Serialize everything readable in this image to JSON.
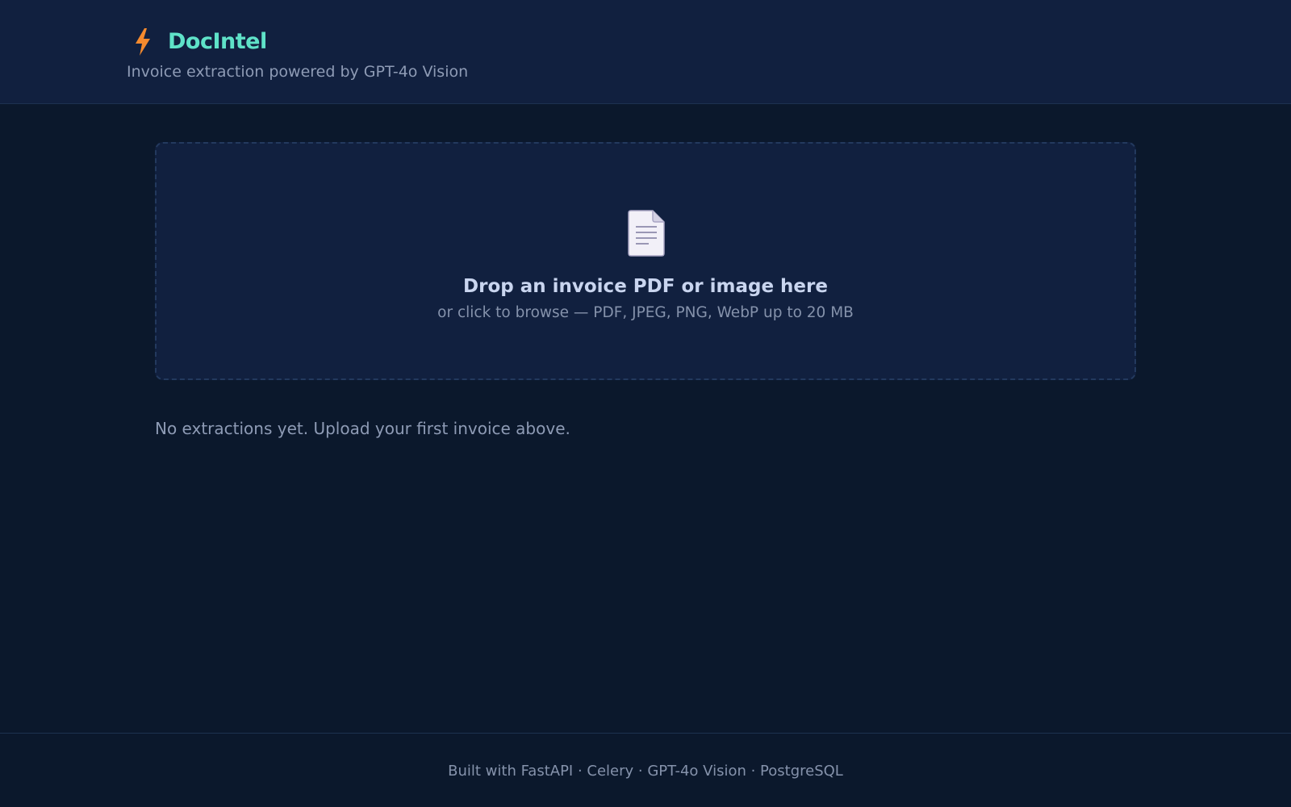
{
  "header": {
    "app_name": "DocIntel",
    "logo_icon": "lightning-bolt-icon",
    "tagline": "Invoice extraction powered by GPT-4o Vision"
  },
  "upload": {
    "icon": "document-icon",
    "title": "Drop an invoice PDF or image here",
    "subtitle": "or click to browse — PDF, JPEG, PNG, WebP up to 20 MB"
  },
  "extractions": {
    "empty_message": "No extractions yet. Upload your first invoice above."
  },
  "footer": {
    "text": "Built with FastAPI · Celery · GPT-4o Vision · PostgreSQL"
  },
  "colors": {
    "background": "#0b182c",
    "header_background": "#11203f",
    "brand_accent": "#5fe2c8",
    "bolt": "#f58a2e",
    "dropzone_border": "#23395e",
    "muted_text": "#8e9bb5",
    "heading_text": "#c9d5ef"
  }
}
